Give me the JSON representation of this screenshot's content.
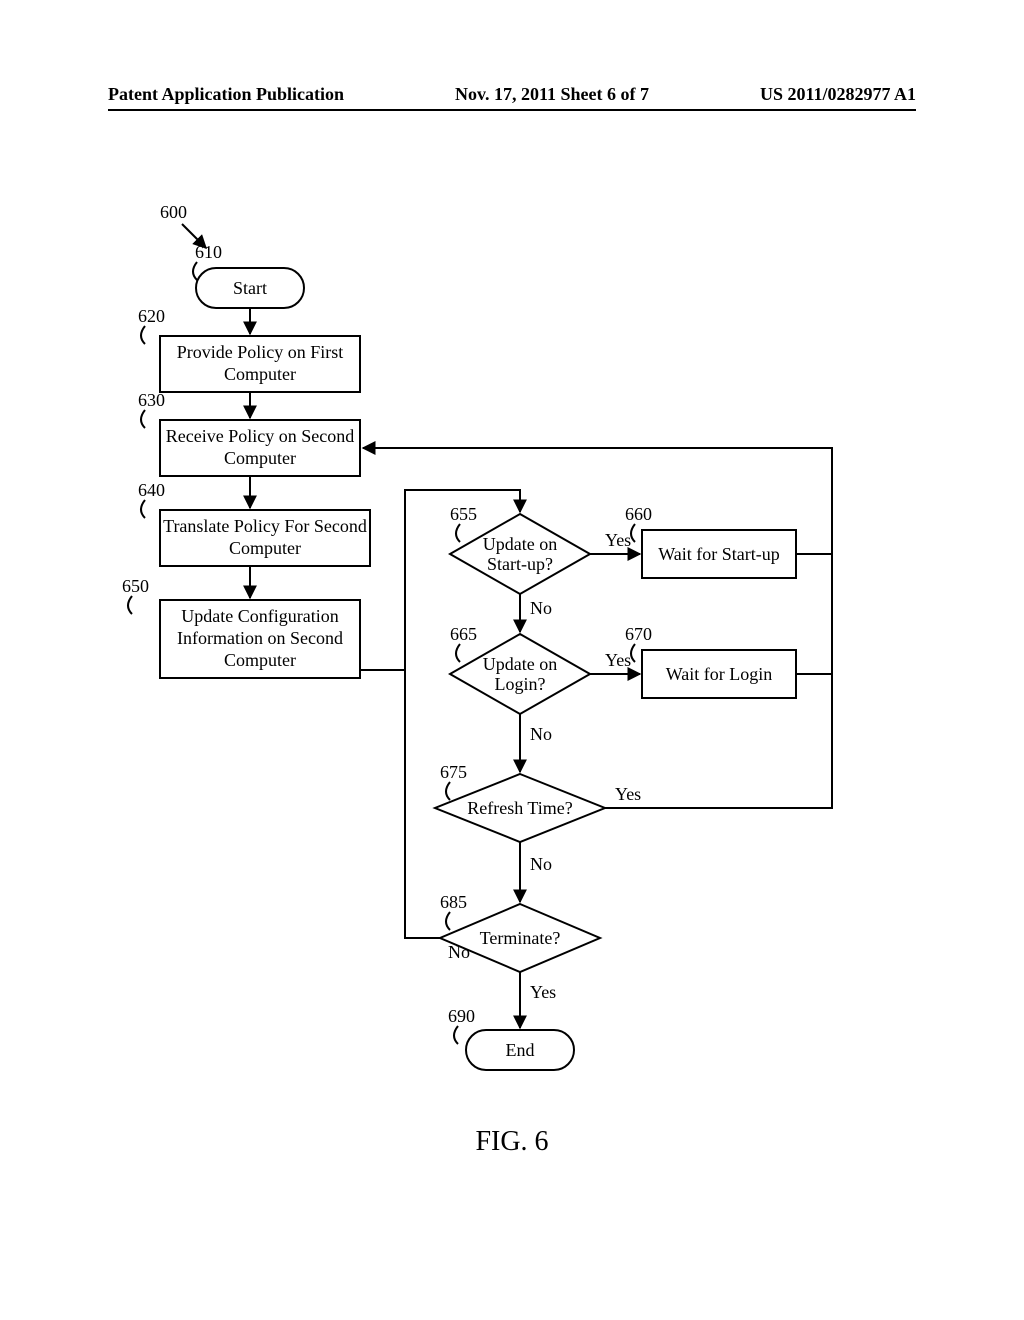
{
  "header": {
    "left": "Patent Application Publication",
    "center": "Nov. 17, 2011  Sheet 6 of 7",
    "right": "US 2011/0282977 A1"
  },
  "figure_label": "FIG. 6",
  "refs": {
    "r600": "600",
    "r610": "610",
    "r620": "620",
    "r630": "630",
    "r640": "640",
    "r650": "650",
    "r655": "655",
    "r660": "660",
    "r665": "665",
    "r670": "670",
    "r675": "675",
    "r685": "685",
    "r690": "690"
  },
  "nodes": {
    "start": "Start",
    "provide_line1": "Provide Policy on First",
    "provide_line2": "Computer",
    "receive_line1": "Receive Policy on Second",
    "receive_line2": "Computer",
    "translate_line1": "Translate Policy For Second",
    "translate_line2": "Computer",
    "update_cfg_line1": "Update Configuration",
    "update_cfg_line2": "Information on Second",
    "update_cfg_line3": "Computer",
    "update_startup_line1": "Update on",
    "update_startup_line2": "Start-up?",
    "wait_startup": "Wait for Start-up",
    "update_login_line1": "Update on",
    "update_login_line2": "Login?",
    "wait_login": "Wait for Login",
    "refresh": "Refresh Time?",
    "terminate": "Terminate?",
    "end": "End"
  },
  "edges": {
    "yes": "Yes",
    "no": "No"
  }
}
